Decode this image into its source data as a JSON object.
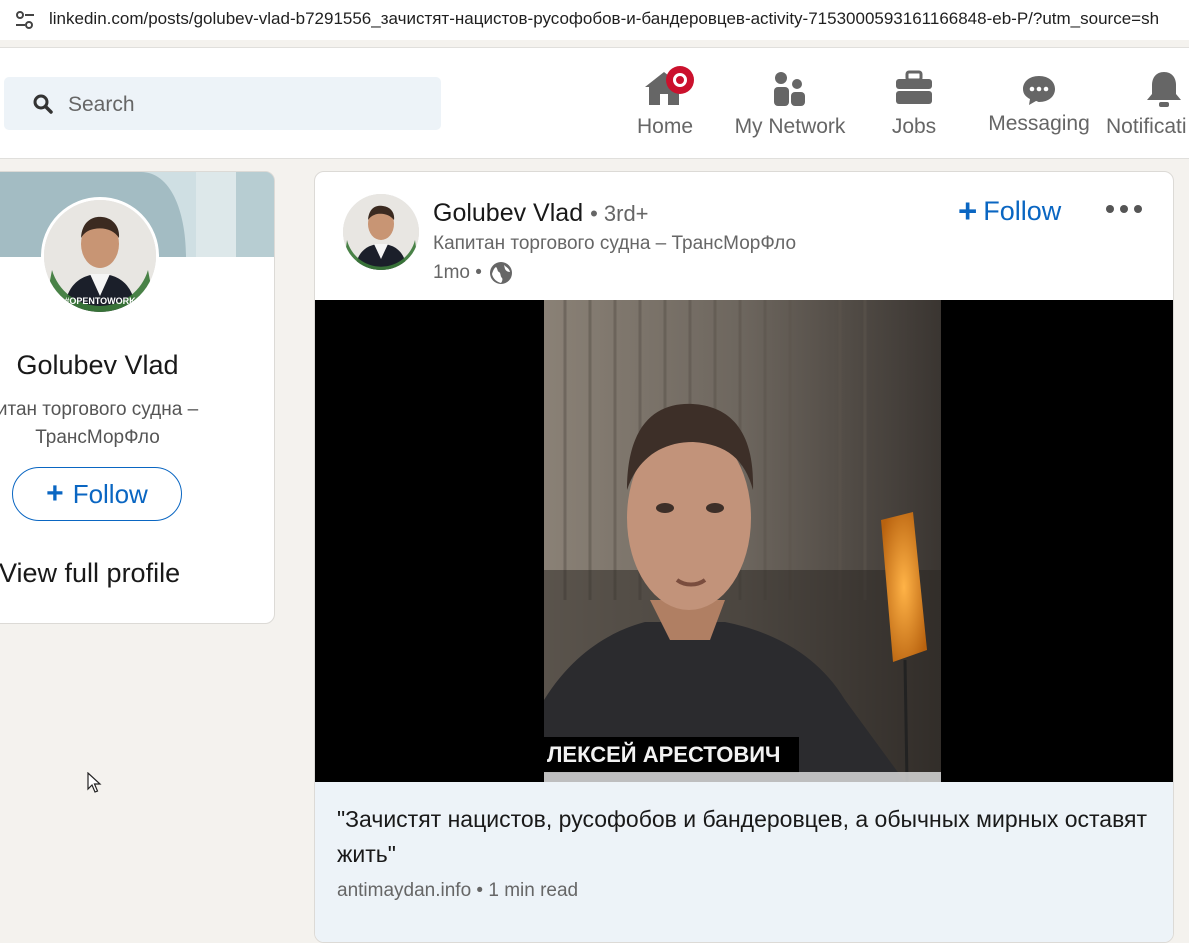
{
  "browser": {
    "url": "linkedin.com/posts/golubev-vlad-b7291556_зачистят-нацистов-русофобов-и-бандеровцев-activity-7153000593161166848-eb-P/?utm_source=sh",
    "tune_icon": "site-settings-icon"
  },
  "nav": {
    "search_placeholder": "Search",
    "items": [
      {
        "label": "Home",
        "icon": "home-icon"
      },
      {
        "label": "My Network",
        "icon": "people-icon"
      },
      {
        "label": "Jobs",
        "icon": "briefcase-icon"
      },
      {
        "label": "Messaging",
        "icon": "chat-icon"
      },
      {
        "label": "Notificati",
        "icon": "bell-icon"
      }
    ],
    "accent": "#0a66c2",
    "badge_color": "#cb112d"
  },
  "profile_card": {
    "name": "Golubev Vlad",
    "headline": "итан торгового судна – ТрансМорФло",
    "follow_label": "Follow",
    "view_profile": "View full profile",
    "avatar_badge": "#OPENTOWORK"
  },
  "post": {
    "author": "Golubev Vlad",
    "degree": "• 3rd+",
    "headline": "Капитан торгового судна – ТрансМорФло",
    "time": "1mo •",
    "follow_label": "Follow",
    "video_caption": "ЛЕКСЕЙ АРЕСТОВИЧ",
    "article_title": "\"Зачистят нацистов, русофобов и бандеровцев, а обычных мирных оставят жить\"",
    "article_meta": "antimaydan.info • 1 min read"
  }
}
